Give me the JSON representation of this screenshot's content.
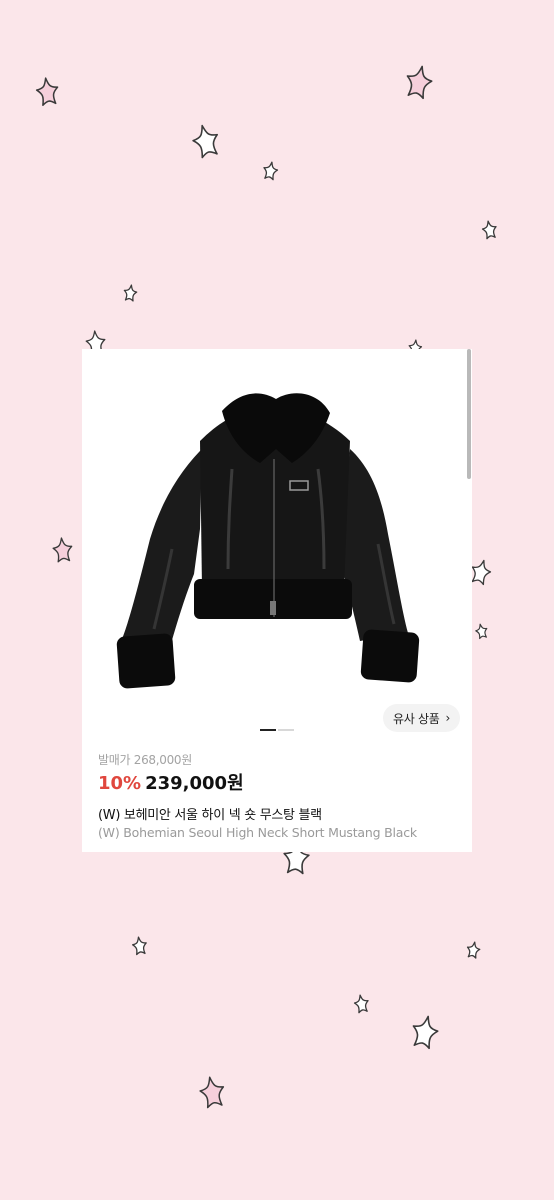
{
  "colors": {
    "background": "#fbe6ea",
    "discount": "#e0473e",
    "star_pink": "#f6cfdb",
    "star_white": "#ffffff",
    "star_outline": "#3a3a3a"
  },
  "product": {
    "image_icon": "black-shearling-jacket",
    "similar_button_label": "유사 상품",
    "similar_button_icon": "chevron-right-icon",
    "carousel": {
      "current": 1,
      "total": 2
    },
    "retail_price": "발매가 268,000원",
    "discount": "10%",
    "price": "239,000원",
    "name_ko": "(W) 보헤미안 서울 하이 넥 숏 무스탕 블랙",
    "name_en": "(W) Bohemian Seoul High Neck Short Mustang Black"
  }
}
